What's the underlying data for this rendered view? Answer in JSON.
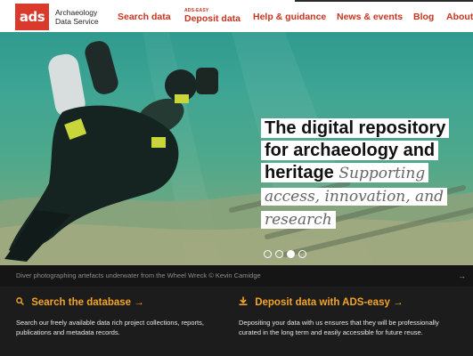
{
  "logo": {
    "mark": "ads",
    "line1": "Archaeology",
    "line2": "Data Service"
  },
  "nav": {
    "search": "Search data",
    "deposit_super": "ADS-EASY",
    "deposit": "Deposit data",
    "help": "Help & guidance",
    "news": "News & events",
    "blog": "Blog",
    "about": "About"
  },
  "hero": {
    "line1": "The digital repository",
    "line2": "for archaeology and",
    "line3_bold": "heritage",
    "line3_italic": "Supporting",
    "line4": "access, innovation, and",
    "line5": "research",
    "slides": 4,
    "active_slide": 3
  },
  "caption": {
    "text": "Diver photographing artefacts underwater from the Wheel Wreck © Kevin Camidge",
    "arrow": "→"
  },
  "cards": {
    "search": {
      "icon": "search-icon",
      "title": "Search the database",
      "arrow": "→",
      "body": "Search our freely available data rich project collections, reports, publications and metadata records."
    },
    "deposit": {
      "icon": "download-icon",
      "title": "Deposit data with ADS-easy",
      "arrow": "→",
      "body": "Depositing your data with us ensures that they will be professionally curated in the long term and easily accessible for future reuse."
    }
  },
  "colors": {
    "brand": "#d93a2b",
    "nav": "#c8341f",
    "accent": "#f4a428"
  }
}
